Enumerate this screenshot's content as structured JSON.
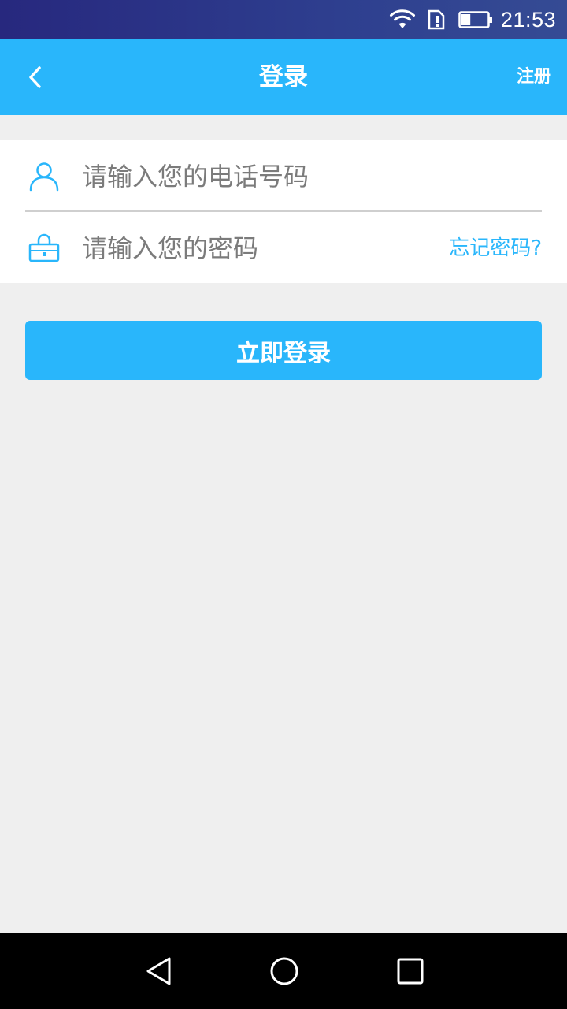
{
  "status_bar": {
    "time": "21:53",
    "icons": [
      "wifi-icon",
      "sim-alert-icon",
      "battery-icon"
    ],
    "battery_level": 0.35
  },
  "header": {
    "back_icon": "chevron-left-icon",
    "title": "登录",
    "register_label": "注册"
  },
  "form": {
    "phone": {
      "icon": "user-icon",
      "placeholder": "请输入您的电话号码",
      "value": ""
    },
    "password": {
      "icon": "lock-icon",
      "placeholder": "请输入您的密码",
      "value": ""
    },
    "forgot_label": "忘记密码?"
  },
  "login_button": {
    "label": "立即登录"
  },
  "nav_bar": {
    "buttons": [
      "back-triangle-icon",
      "home-circle-icon",
      "recents-square-icon"
    ]
  },
  "colors": {
    "accent": "#29b6fb",
    "status_bar": "#2e3f8f",
    "background": "#efefef",
    "placeholder": "#7b7b7b",
    "nav_bar": "#000000"
  }
}
